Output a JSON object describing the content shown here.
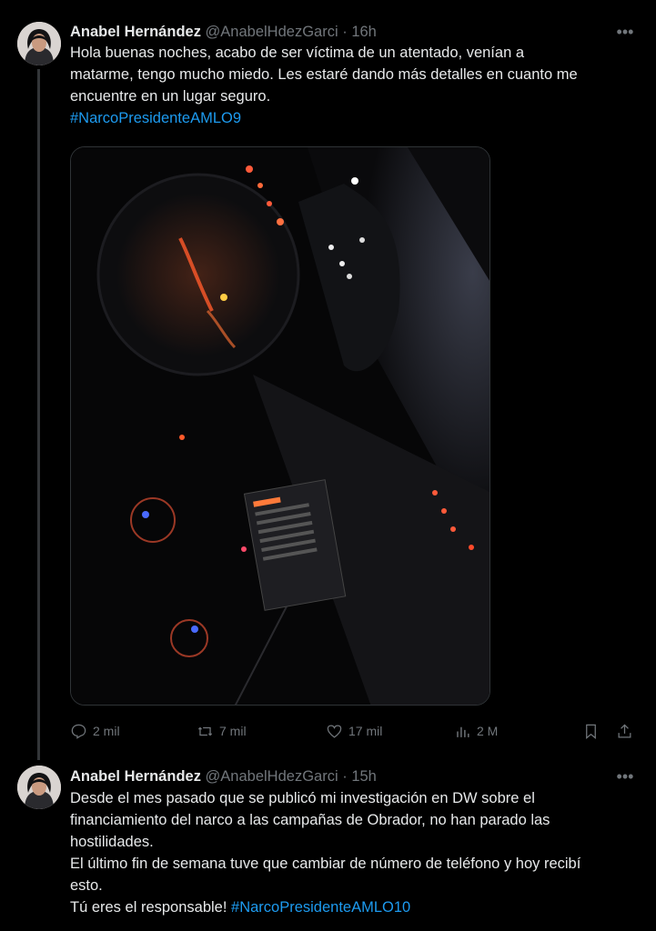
{
  "tweets": [
    {
      "author_name": "Anabel Hernández",
      "handle": "@AnabelHdezGarci",
      "separator": "·",
      "time": "16h",
      "text_lines": [
        "Hola buenas noches, acabo de ser víctima de un atentado, venían a",
        "matarme, tengo mucho miedo. Les estaré dando más detalles en cuanto me",
        "encuentre en un lugar seguro."
      ],
      "hashtag": "#NarcoPresidenteAMLO9",
      "media_description": "night-car-dashboard-photo",
      "actions": {
        "replies": "2 mil",
        "retweets": "7 mil",
        "likes": "17 mil",
        "views": "2 M"
      }
    },
    {
      "author_name": "Anabel Hernández",
      "handle": "@AnabelHdezGarci",
      "separator": "·",
      "time": "15h",
      "text_lines": [
        "Desde el mes pasado que se publicó mi investigación en DW sobre el",
        "financiamiento del narco a las campañas de Obrador, no han parado las",
        "hostilidades.",
        "El último fin de semana tuve que cambiar de número de teléfono y hoy recibí",
        "esto."
      ],
      "last_line_text": "Tú eres el responsable! ",
      "hashtag": "#NarcoPresidenteAMLO10"
    }
  ],
  "icons": {
    "more": "more-horizontal-icon",
    "reply": "reply-icon",
    "retweet": "retweet-icon",
    "like": "heart-icon",
    "views": "views-chart-icon",
    "bookmark": "bookmark-icon",
    "share": "share-icon"
  },
  "colors": {
    "background": "#000000",
    "text": "#e7e9ea",
    "secondary": "#71767b",
    "link": "#1d9bf0",
    "border": "#2f3336"
  }
}
